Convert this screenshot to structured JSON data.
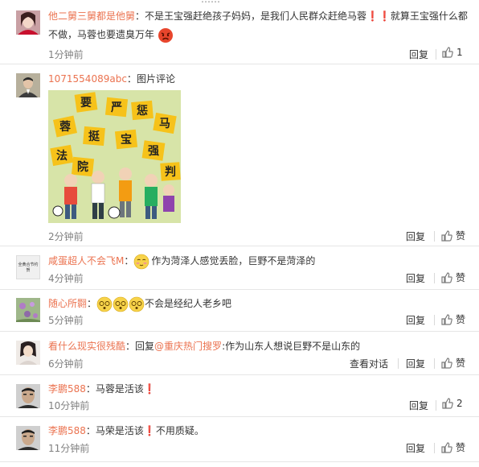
{
  "header_cut": "……",
  "comments": [
    {
      "user": "他二舅三舅都是他舅",
      "sep": "：",
      "text": "不是王宝强赶绝孩子妈妈，是我们人民群众赶绝马蓉❗❗就算王宝强什么都",
      "text2": "不做，马蓉也要遗臭万年",
      "time": "1分钟前",
      "reply": "回复",
      "likes": "1"
    },
    {
      "user": "1071554089abc",
      "sep": "：",
      "text": "图片评论",
      "time": "2分钟前",
      "reply": "回复",
      "likes": "赞",
      "image_chars": [
        "要",
        "严",
        "惩",
        "马",
        "蓉",
        "挺",
        "宝",
        "强",
        "法",
        "院",
        "判",
        "宝"
      ]
    },
    {
      "user": "咸蛋超人不会飞M",
      "sep": "：",
      "text": "作为菏泽人感觉丢脸，巨野不是菏泽的",
      "time": "4分钟前",
      "reply": "回复",
      "likes": "赞",
      "avatar_text": "全黄合节约贺"
    },
    {
      "user": "随心所翾",
      "sep": "：",
      "text": "不会是经纪人老乡吧",
      "time": "5分钟前",
      "reply": "回复",
      "likes": "赞"
    },
    {
      "user": "看什么现实很残酷",
      "sep": "：",
      "text_pre": "回复",
      "mention": "@重庆热门搜罗",
      "text": ":作为山东人想说巨野不是山东的",
      "time": "6分钟前",
      "view_thread": "查看对话",
      "reply": "回复",
      "likes": "赞"
    },
    {
      "user": "李鹏588",
      "sep": "：",
      "text": "马蓉是活该❗",
      "time": "10分钟前",
      "reply": "回复",
      "likes": "2"
    },
    {
      "user": "李鹏588",
      "sep": "：",
      "text": "马荣是活该❗不用质疑。",
      "time": "11分钟前",
      "reply": "回复",
      "likes": "赞"
    }
  ],
  "colors": {
    "username": "#eb7350",
    "meta": "#808080",
    "divider": "#e6e6e6"
  }
}
